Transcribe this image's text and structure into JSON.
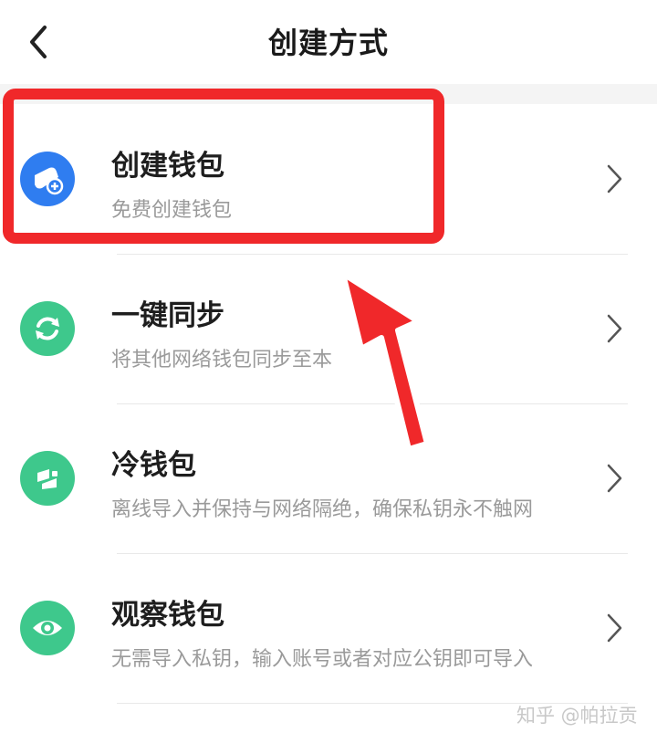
{
  "header": {
    "title": "创建方式"
  },
  "options": [
    {
      "title": "创建钱包",
      "description": "免费创建钱包",
      "icon": "wallet-add-icon",
      "icon_color": "#2f7df0"
    },
    {
      "title": "一键同步",
      "description": "将其他网络钱包同步至本",
      "icon": "sync-icon",
      "icon_color": "#3ec88c"
    },
    {
      "title": "冷钱包",
      "description": "离线导入并保持与网络隔绝，确保私钥永不触网",
      "icon": "cold-wallet-icon",
      "icon_color": "#3ec88c"
    },
    {
      "title": "观察钱包",
      "description": "无需导入私钥，输入账号或者对应公钥即可导入",
      "icon": "eye-icon",
      "icon_color": "#3ec88c"
    }
  ],
  "watermark": "知乎 @帕拉贡",
  "colors": {
    "annotation_red": "#f0282a",
    "title_text": "#1e1e1e",
    "desc_text": "#9a9a9a"
  }
}
